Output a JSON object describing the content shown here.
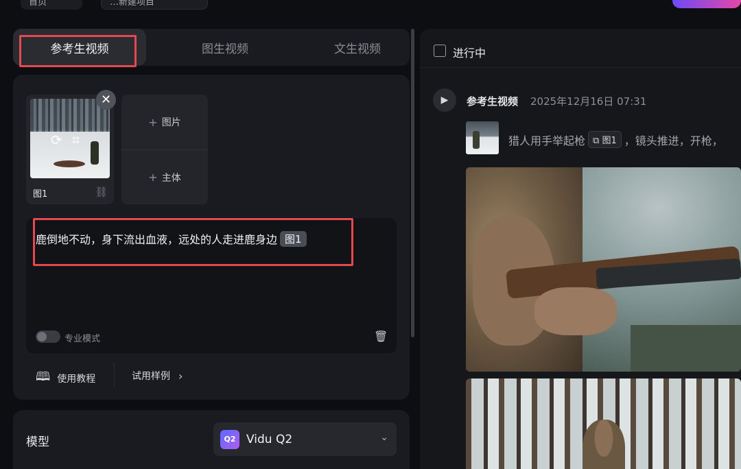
{
  "topbar": {
    "home_label": "首页",
    "title_label": "…新建项目"
  },
  "tabs": [
    "参考生视频",
    "图生视频",
    "文生视频"
  ],
  "reference": {
    "image_label": "图1",
    "add_image": "图片",
    "add_subject": "主体"
  },
  "prompt": {
    "text": "鹿倒地不动，身下流出血液，远处的人走进鹿身边",
    "chip": "图1",
    "pro_mode_label": "专业模式"
  },
  "footer_links": {
    "tutorial": "使用教程",
    "samples": "试用样例"
  },
  "model": {
    "label": "模型",
    "icon_text": "Q2",
    "name": "Vidu Q2"
  },
  "right": {
    "filter_label": "进行中",
    "task": {
      "type": "参考生视频",
      "time": "2025年12月16日 07:31",
      "prompt_before": "猎人用手举起枪",
      "prompt_chip": "图1",
      "prompt_after": "，镜头推进，开枪，"
    }
  }
}
